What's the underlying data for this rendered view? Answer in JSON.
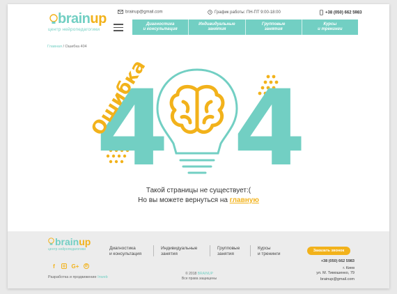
{
  "colors": {
    "accent": "#72cfc3",
    "yellow": "#f2b21b"
  },
  "header": {
    "logo_main": "brain",
    "logo_up": "up",
    "logo_tagline": "центр нейропедагогики",
    "email": "brainup@gmail.com",
    "hours": "График работы: ПН-ПТ 9:00-18:00",
    "phone": "+38 (050) 662 5983"
  },
  "nav": {
    "items": [
      {
        "label": "Диагностика\nи консультация"
      },
      {
        "label": "Индивидуальные\nзанятия"
      },
      {
        "label": "Групповые\nзанятия"
      },
      {
        "label": "Курсы\nи тренинги"
      }
    ]
  },
  "breadcrumb": {
    "home": "Главная",
    "sep": " / ",
    "current": "Ошибка 404"
  },
  "hero": {
    "error_word": "Ошибка",
    "digit_left": "4",
    "digit_right": "4"
  },
  "message": {
    "line1": "Такой страницы не существует:(",
    "line2_prefix": "Но вы можете вернуться на ",
    "line2_link": "главную"
  },
  "footer": {
    "logo_main": "brain",
    "logo_up": "up",
    "logo_tagline": "центр нейропедагогики",
    "links": [
      {
        "label": "Диагностика\nи консультация"
      },
      {
        "label": "Индивидуальные\nзанятия"
      },
      {
        "label": "Групповые\nзанятия"
      },
      {
        "label": "Курсы\nи тренинги"
      }
    ],
    "social_icons": [
      "facebook-icon",
      "instagram-icon",
      "google-plus-icon",
      "viber-icon"
    ],
    "developer_prefix": "Разработка и продвижение ",
    "developer_name": "Inweb",
    "copyright_prefix": "© 2018 ",
    "copyright_brand": "BRAINUP",
    "rights": "Все права защищены",
    "call_button": "Заказать звонок",
    "phone": "+38 (050) 662 5983",
    "city": "г. Киев",
    "street": "ул. М. Тимошенко, 79",
    "email": "brainup@gmail.com"
  }
}
